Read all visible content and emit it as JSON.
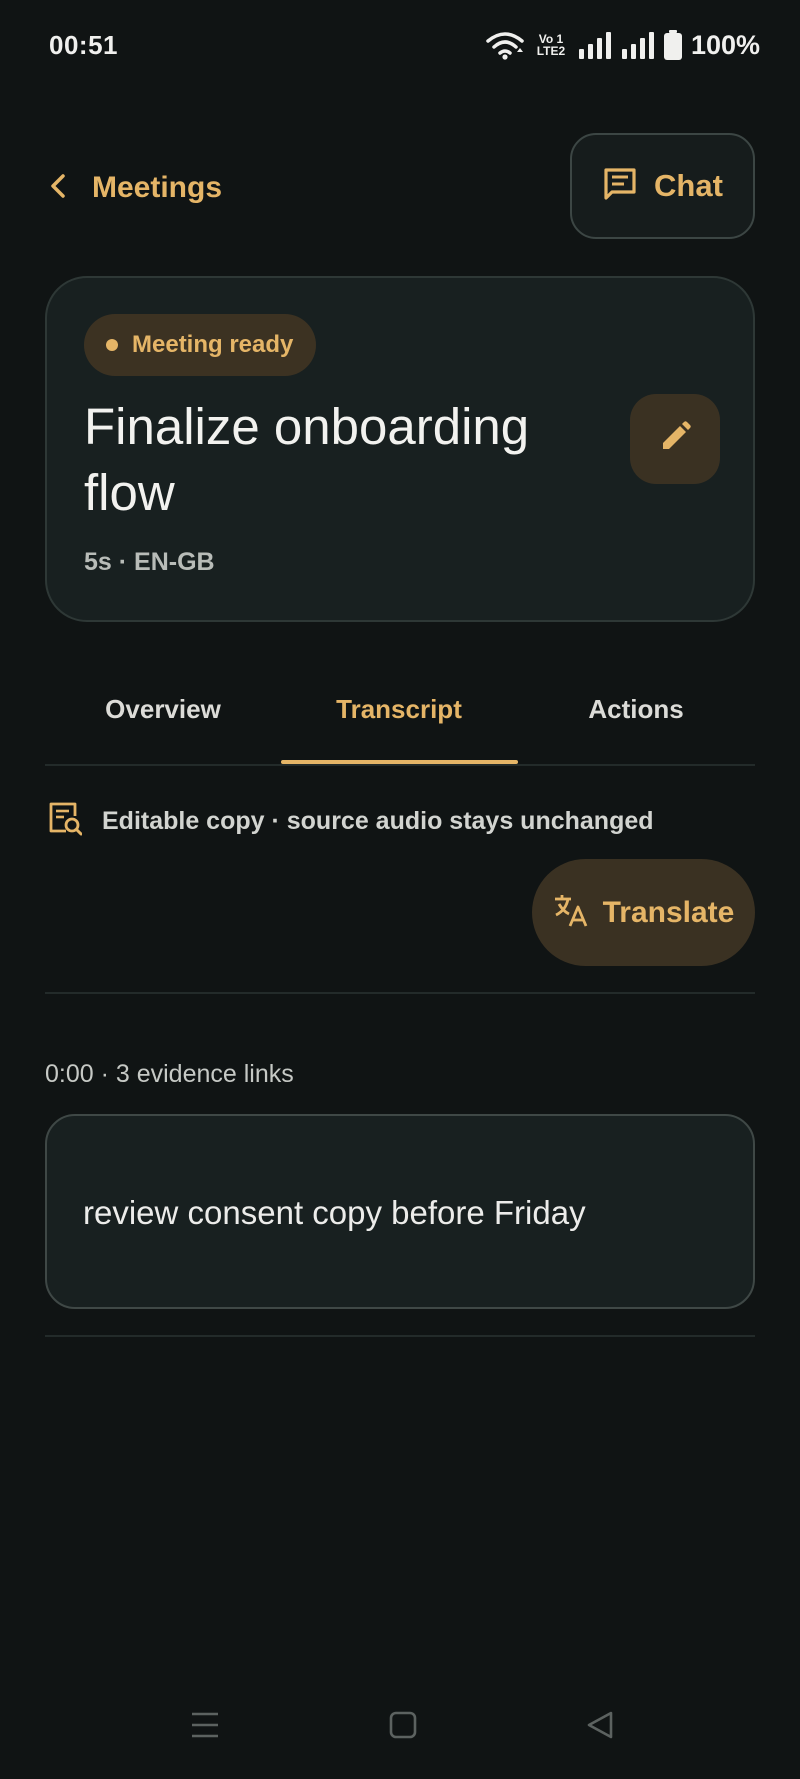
{
  "status_bar": {
    "time": "00:51",
    "volte_line1": "Vo 1",
    "volte_line2": "LTE2",
    "battery": "100%"
  },
  "header": {
    "back_label": "Meetings",
    "chat_label": "Chat"
  },
  "meeting": {
    "status": "Meeting ready",
    "title": "Finalize onboarding flow",
    "meta": "5s · EN-GB"
  },
  "tabs": [
    {
      "label": "Overview",
      "active": false
    },
    {
      "label": "Transcript",
      "active": true
    },
    {
      "label": "Actions",
      "active": false
    }
  ],
  "transcript": {
    "notice": "Editable copy · source audio stays unchanged",
    "translate_label": "Translate",
    "segments": [
      {
        "meta": "0:00 · 3 evidence links",
        "text": "review consent copy before Friday"
      }
    ]
  },
  "colors": {
    "background": "#101414",
    "accent": "#e5b567",
    "card": "#182020",
    "accent_fill": "#3a3122"
  }
}
